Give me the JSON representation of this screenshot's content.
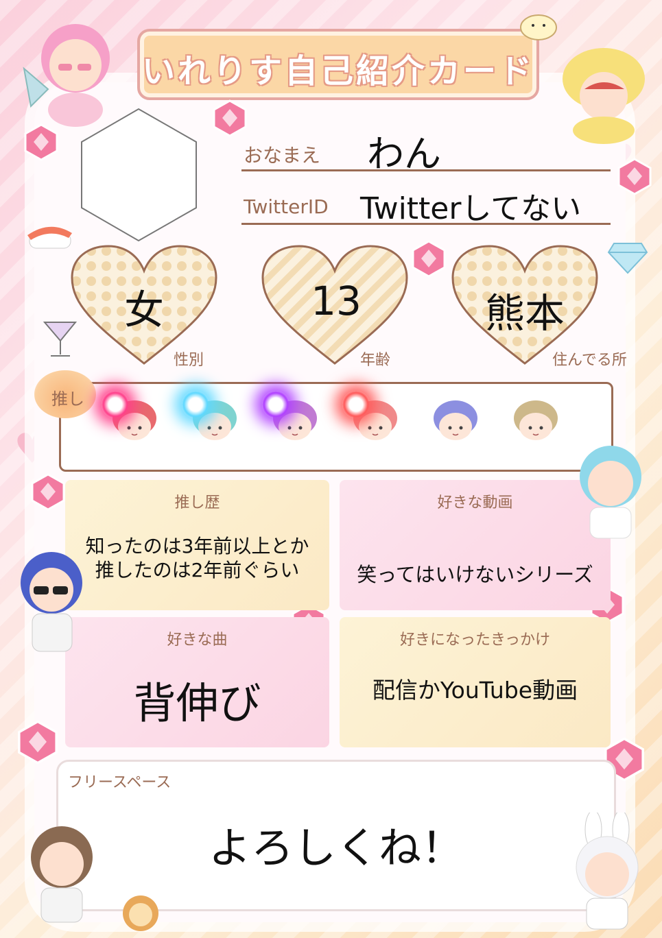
{
  "card_title": "いれりす自己紹介カード",
  "profile": {
    "name_label": "おなまえ",
    "name_value": "わん",
    "twitter_label": "TwitterID",
    "twitter_value": "Twitterしてない"
  },
  "hearts": [
    {
      "label": "性別",
      "value": "女"
    },
    {
      "label": "年齢",
      "value": "13"
    },
    {
      "label": "住んでる所",
      "value": "熊本"
    }
  ],
  "oshi": {
    "label": "推し",
    "members": [
      {
        "hair": "#e86a6e",
        "selected": true,
        "glow": "#ff3f8a"
      },
      {
        "hair": "#7fd3d0",
        "selected": true,
        "glow": "#5fd8ff"
      },
      {
        "hair": "#c07bd2",
        "selected": true,
        "glow": "#b040ff"
      },
      {
        "hair": "#f08a8a",
        "selected": true,
        "glow": "#ff5a5a"
      },
      {
        "hair": "#8c8fe0",
        "selected": false,
        "glow": ""
      },
      {
        "hair": "#cdb88a",
        "selected": false,
        "glow": ""
      }
    ]
  },
  "panels": {
    "history": {
      "title": "推し歴",
      "text_line1": "知ったのは3年前以上とか",
      "text_line2": "推したのは2年前ぐらい"
    },
    "fav_video": {
      "title": "好きな動画",
      "text": "笑ってはいけないシリーズ"
    },
    "fav_song": {
      "title": "好きな曲",
      "text": "背伸び"
    },
    "trigger": {
      "title": "好きになったきっかけ",
      "text": "配信かYouTube動画"
    }
  },
  "free_space": {
    "title": "フリースペース",
    "text": "よろしくね！"
  },
  "colors": {
    "accent_brown": "#9a6b54",
    "pink": "#f58fb0",
    "cream": "#fbd7a6"
  }
}
